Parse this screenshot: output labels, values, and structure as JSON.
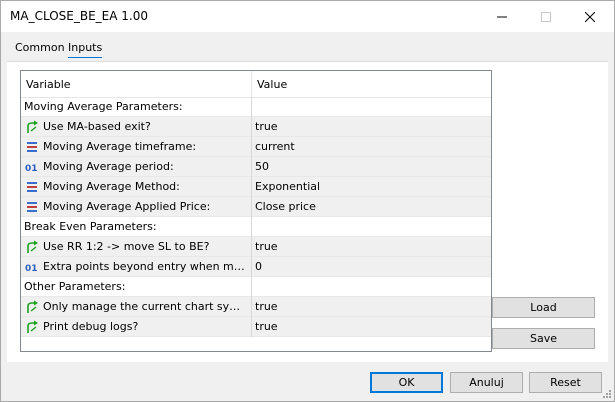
{
  "window": {
    "title": "MA_CLOSE_BE_EA 1.00"
  },
  "tabs": [
    {
      "label": "Common"
    },
    {
      "label": "Inputs"
    }
  ],
  "grid": {
    "header": {
      "variable": "Variable",
      "value": "Value"
    },
    "rows": [
      {
        "label": "Moving Average Parameters:",
        "value": "",
        "icon": "none",
        "group": true
      },
      {
        "label": "Use MA-based exit?",
        "value": "true",
        "icon": "bool-arrow-icon"
      },
      {
        "label": "Moving Average timeframe:",
        "value": "current",
        "icon": "enum-list-icon"
      },
      {
        "label": "Moving Average period:",
        "value": "50",
        "icon": "integer-01-icon"
      },
      {
        "label": "Moving Average Method:",
        "value": "Exponential",
        "icon": "enum-list-icon"
      },
      {
        "label": "Moving Average Applied Price:",
        "value": "Close price",
        "icon": "enum-list-icon"
      },
      {
        "label": "Break Even Parameters:",
        "value": "",
        "icon": "none",
        "group": true
      },
      {
        "label": "Use RR 1:2 -> move SL to BE?",
        "value": "true",
        "icon": "bool-arrow-icon"
      },
      {
        "label": "Extra points beyond entry when moving...",
        "value": "0",
        "icon": "integer-01-icon"
      },
      {
        "label": "Other Parameters:",
        "value": "",
        "icon": "none",
        "group": true
      },
      {
        "label": "Only manage the current chart symbol?",
        "value": "true",
        "icon": "bool-arrow-icon"
      },
      {
        "label": "Print debug logs?",
        "value": "true",
        "icon": "bool-arrow-icon"
      }
    ]
  },
  "side_buttons": {
    "load": "Load",
    "save": "Save"
  },
  "footer": {
    "ok": "OK",
    "cancel": "Anuluj",
    "reset": "Reset"
  },
  "colors": {
    "accent": "#0078d7",
    "bool_icon": "#1aa31a",
    "enum_icon": "#3a6fd0",
    "int_icon": "#2a5fc0"
  }
}
